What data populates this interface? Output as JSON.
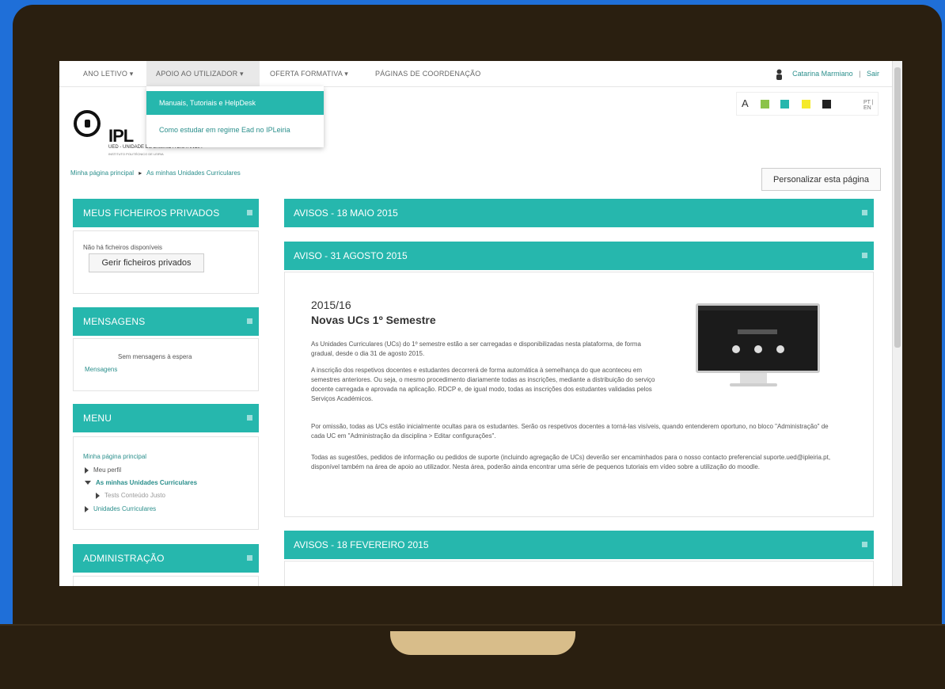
{
  "nav": {
    "items": [
      "ANO LETIVO ▾",
      "APOIO AO UTILIZADOR ▾",
      "OFERTA FORMATIVA ▾",
      "PÁGINAS DE COORDENAÇÃO"
    ],
    "user_name": "Catarina Marmiano",
    "separator": "|",
    "logout": "Sair"
  },
  "dropdown": {
    "items": [
      "Manuais, Tutoriais e HelpDesk",
      "Como estudar em regime Ead no IPLeiria"
    ]
  },
  "logo": {
    "text": "IPL",
    "subtitle": "UED - UNIDADE DE ENSINO A DISTÂNCIA",
    "subline": "INSTITUTO POLITÉCNICO DE LEIRIA"
  },
  "accessibility": {
    "font_label": "A",
    "swatches": [
      "#8bc34a",
      "#26b7ad",
      "#f5ea2a",
      "#222222"
    ],
    "lang": "PT | EN"
  },
  "breadcrumb": {
    "home": "Minha página principal",
    "sep": "▸",
    "current": "As minhas Unidades Curriculares"
  },
  "customise_button": "Personalizar esta página",
  "blocks": {
    "private_files": {
      "title": "MEUS FICHEIROS PRIVADOS",
      "empty": "Não há ficheiros disponíveis",
      "button": "Gerir ficheiros privados"
    },
    "messages": {
      "title": "MENSAGENS",
      "none": "Sem mensagens à espera",
      "link": "Mensagens"
    },
    "menu": {
      "title": "MENU",
      "home": "Minha página principal",
      "profile": "Meu perfil",
      "my_courses": "As minhas Unidades Curriculares",
      "sub": "Tests Conteúdo Justo",
      "courses": "Unidades Curriculares"
    },
    "admin": {
      "title": "ADMINISTRAÇÃO"
    }
  },
  "news": {
    "n1_title": "AVISOS - 18 MAIO 2015",
    "n2_title": "AVISO - 31 AGOSTO 2015",
    "n3_title": "AVISOS - 18 FEVEREIRO 2015",
    "year": "2015/16",
    "headline": "Novas UCs 1º Semestre",
    "p1": "As Unidades Curriculares (UCs) do 1º semestre estão a ser carregadas e disponibilizadas nesta plataforma, de forma gradual, desde o dia 31 de agosto 2015.",
    "p2": "A inscrição dos respetivos docentes e estudantes decorrerá de forma automática à semelhança do que aconteceu em semestres anteriores. Ou seja, o mesmo procedimento diariamente todas as inscrições, mediante a distribuição do serviço docente carregada e aprovada na aplicação. RDCP e, de igual modo, todas as inscrições dos estudantes validadas pelos Serviços Académicos.",
    "p3": "Por omissão, todas as UCs estão inicialmente ocultas para os estudantes. Serão os respetivos docentes a torná-las visíveis, quando entenderem oportuno, no bloco \"Administração\" de cada UC em \"Administração da disciplina > Editar configurações\".",
    "p4": "Todas as sugestões, pedidos de informação ou pedidos de suporte (incluindo agregação de UCs) deverão ser encaminhados para o nosso contacto preferencial suporte.ued@ipleiria.pt, disponível também na área de apoio ao utilizador. Nesta área, poderão ainda encontrar uma série de pequenos tutoriais em vídeo sobre a utilização do moodle."
  }
}
